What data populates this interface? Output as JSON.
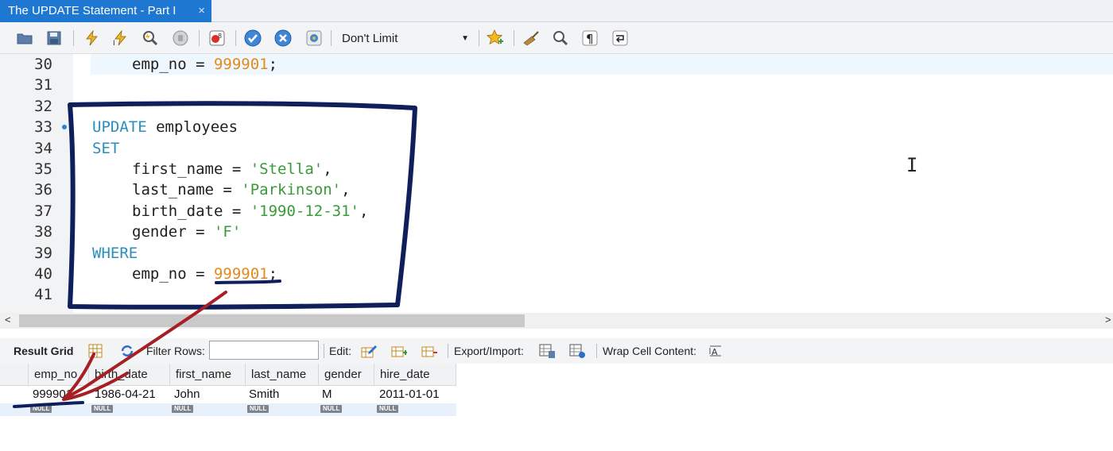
{
  "tab": {
    "title": "The UPDATE Statement - Part I",
    "close": "×"
  },
  "toolbar": {
    "limit_value": "Don't Limit"
  },
  "editor": {
    "lines": [
      {
        "num": "30"
      },
      {
        "num": "31"
      },
      {
        "num": "32"
      },
      {
        "num": "33"
      },
      {
        "num": "34"
      },
      {
        "num": "35"
      },
      {
        "num": "36"
      },
      {
        "num": "37"
      },
      {
        "num": "38"
      },
      {
        "num": "39"
      },
      {
        "num": "40"
      },
      {
        "num": "41"
      }
    ],
    "code": {
      "l30_a": "emp_no = ",
      "l30_num": "999901",
      "l30_b": ";",
      "l33_kw": "UPDATE",
      "l33_b": " employees",
      "l34_kw": "SET",
      "l35_a": "first_name = ",
      "l35_str": "'Stella'",
      "l35_b": ",",
      "l36_a": "last_name = ",
      "l36_str": "'Parkinson'",
      "l36_b": ",",
      "l37_a": "birth_date = ",
      "l37_str": "'1990-12-31'",
      "l37_b": ",",
      "l38_a": "gender = ",
      "l38_str": "'F'",
      "l39_kw": "WHERE",
      "l40_a": "emp_no = ",
      "l40_num": "999901",
      "l40_b": ";"
    }
  },
  "results_toolbar": {
    "result_grid": "Result Grid",
    "filter_rows": "Filter Rows:",
    "filter_value": "",
    "edit": "Edit:",
    "export_import": "Export/Import:",
    "wrap_cell": "Wrap Cell Content:"
  },
  "grid": {
    "columns": [
      "emp_no",
      "birth_date",
      "first_name",
      "last_name",
      "gender",
      "hire_date"
    ],
    "row": [
      "999901",
      "1986-04-21",
      "John",
      "Smith",
      "M",
      "2011-01-01"
    ],
    "null_label": "NULL"
  },
  "colors": {
    "tab_active": "#1e78d2",
    "keyword": "#2a8fbd",
    "string": "#3a9a3a",
    "number": "#e38a1e",
    "annotation_box": "#0f1f5c",
    "annotation_arrow": "#a51f24"
  }
}
